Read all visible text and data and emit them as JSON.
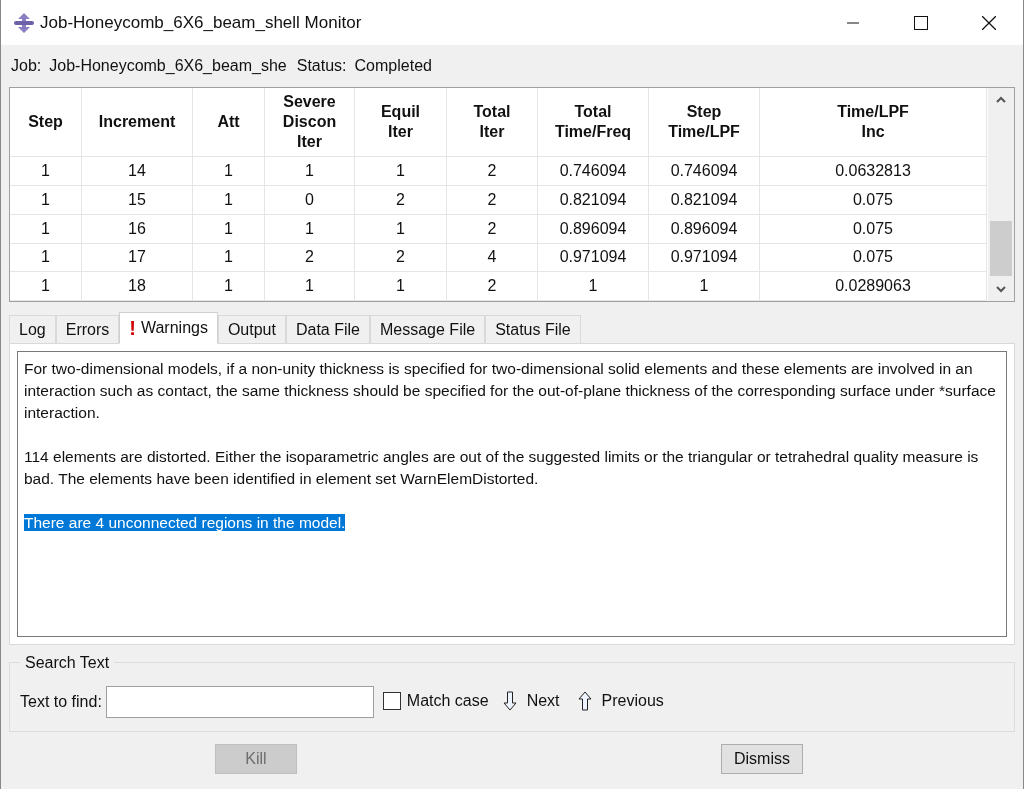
{
  "window": {
    "title": "Job-Honeycomb_6X6_beam_shell Monitor"
  },
  "job": {
    "label": "Job:",
    "name": "Job-Honeycomb_6X6_beam_she",
    "status_label": "Status:",
    "status": "Completed"
  },
  "table": {
    "columns": [
      "Step",
      "Increment",
      "Att",
      "Severe\nDiscon\nIter",
      "Equil\nIter",
      "Total\nIter",
      "Total\nTime/Freq",
      "Step\nTime/LPF",
      "Time/LPF\nInc"
    ],
    "rows": [
      [
        "1",
        "14",
        "1",
        "1",
        "1",
        "2",
        "0.746094",
        "0.746094",
        "0.0632813"
      ],
      [
        "1",
        "15",
        "1",
        "0",
        "2",
        "2",
        "0.821094",
        "0.821094",
        "0.075"
      ],
      [
        "1",
        "16",
        "1",
        "1",
        "1",
        "2",
        "0.896094",
        "0.896094",
        "0.075"
      ],
      [
        "1",
        "17",
        "1",
        "2",
        "2",
        "4",
        "0.971094",
        "0.971094",
        "0.075"
      ],
      [
        "1",
        "18",
        "1",
        "1",
        "1",
        "2",
        "1",
        "1",
        "0.0289063"
      ]
    ]
  },
  "tabs": [
    {
      "label": "Log",
      "selected": false,
      "warning": false
    },
    {
      "label": "Errors",
      "selected": false,
      "warning": false
    },
    {
      "label": "Warnings",
      "selected": true,
      "warning": true,
      "mark": "!"
    },
    {
      "label": "Output",
      "selected": false,
      "warning": false
    },
    {
      "label": "Data File",
      "selected": false,
      "warning": false
    },
    {
      "label": "Message File",
      "selected": false,
      "warning": false
    },
    {
      "label": "Status File",
      "selected": false,
      "warning": false
    }
  ],
  "messages": [
    {
      "text": "For two-dimensional models, if a non-unity thickness is specified for two-dimensional solid elements and these elements are involved in an interaction such as contact, the same thickness should be specified for the out-of-plane thickness of the corresponding surface under *surface interaction.",
      "selected": false
    },
    {
      "text": "114 elements are distorted. Either the isoparametric angles are out of the suggested limits or the triangular or tetrahedral quality measure is bad. The elements have been identified in element set WarnElemDistorted.",
      "selected": false
    },
    {
      "text": "There are 4 unconnected regions in the model.",
      "selected": true
    }
  ],
  "search": {
    "title": "Search Text",
    "label": "Text to find:",
    "match_case": {
      "label": "Match case",
      "checked": false
    },
    "next": "Next",
    "previous": "Previous"
  },
  "buttons": [
    {
      "label": "Kill",
      "disabled": true
    },
    {
      "label": "Dismiss",
      "disabled": false
    }
  ]
}
